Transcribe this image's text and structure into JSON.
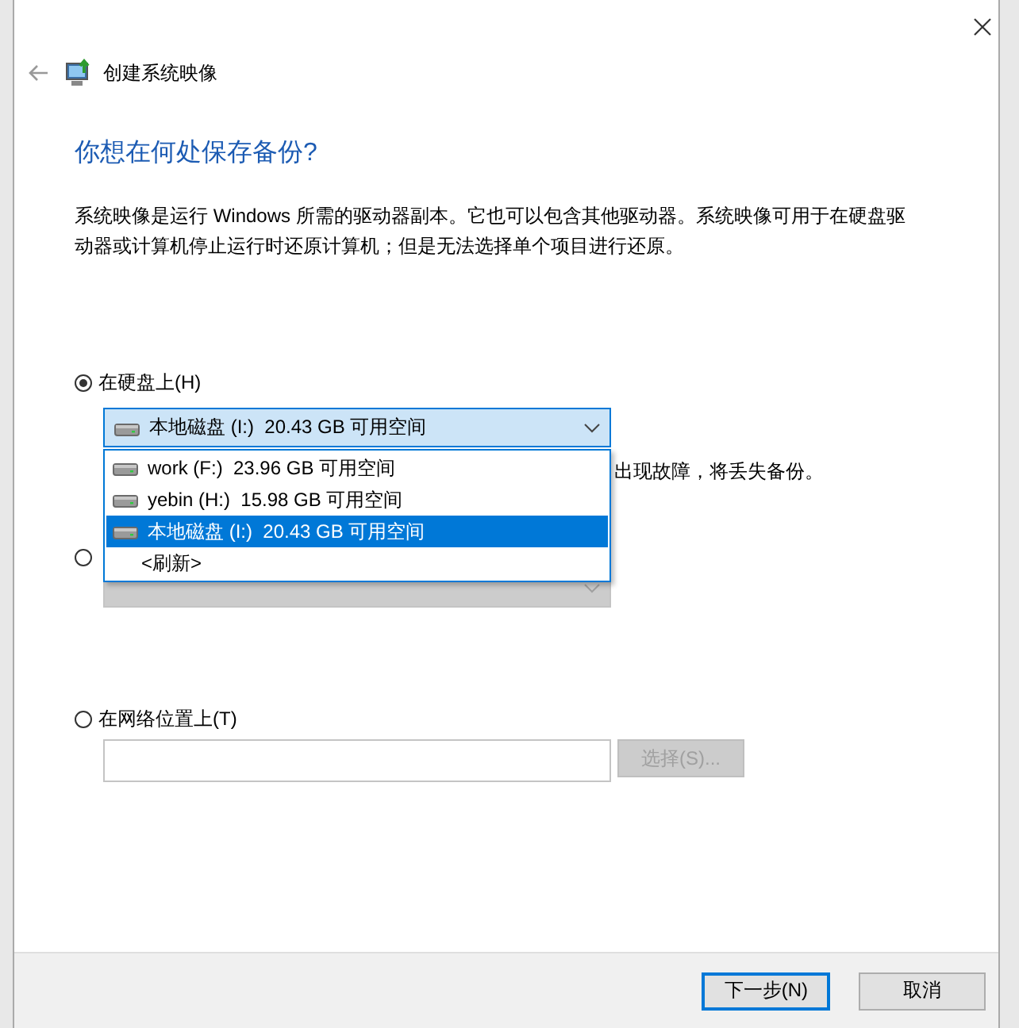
{
  "header": {
    "title": "创建系统映像"
  },
  "heading": "你想在何处保存备份?",
  "description": "系统映像是运行 Windows 所需的驱动器副本。它也可以包含其他驱动器。系统映像可用于在硬盘驱动器或计算机停止运行时还原计算机；但是无法选择单个项目进行还原。",
  "options": [
    {
      "kind": "combo",
      "label": "在硬盘上(H)",
      "selected": true,
      "note": "出现故障，将丢失备份。",
      "combo": {
        "value": "本地磁盘 (I:)  20.43 GB 可用空间",
        "expanded": true,
        "disabled": false,
        "items": [
          {
            "kind": "drive",
            "label": "work (F:)  23.96 GB 可用空间",
            "selected": false
          },
          {
            "kind": "drive",
            "label": "yebin (H:)  15.98 GB 可用空间",
            "selected": false
          },
          {
            "kind": "drive",
            "label": "本地磁盘 (I:)  20.43 GB 可用空间",
            "selected": true
          },
          {
            "kind": "command",
            "label": "<刷新>",
            "selected": false
          }
        ]
      }
    },
    {
      "kind": "combo",
      "selected": false,
      "combo": {
        "expanded": false,
        "disabled": true
      }
    },
    {
      "kind": "field",
      "label": "在网络位置上(T)",
      "selected": false,
      "button": {
        "label": "选择(S)...",
        "disabled": true
      }
    }
  ],
  "buttons": [
    {
      "label": "下一步(N)",
      "default": true
    },
    {
      "label": "取消",
      "default": false
    }
  ]
}
